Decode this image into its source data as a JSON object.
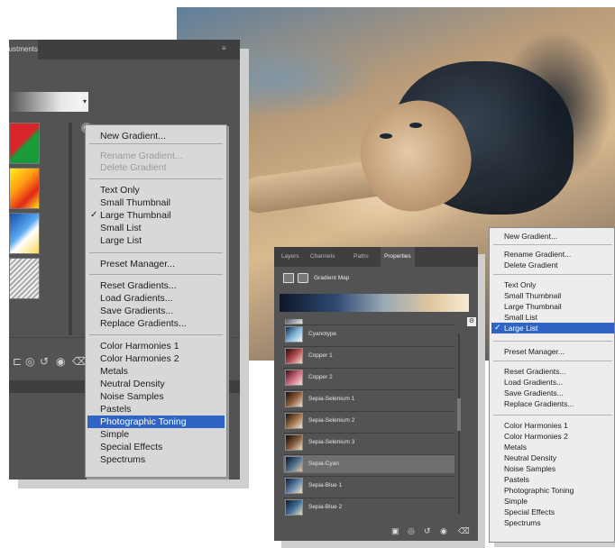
{
  "left_panel": {
    "tab_label": "Adjustments",
    "menu": {
      "items": [
        {
          "label": "New Gradient...",
          "state": "normal"
        },
        {
          "label": "Rename Gradient...",
          "state": "disabled"
        },
        {
          "label": "Delete Gradient",
          "state": "disabled"
        },
        {
          "label": "Text Only",
          "state": "normal"
        },
        {
          "label": "Small Thumbnail",
          "state": "normal"
        },
        {
          "label": "Large Thumbnail",
          "state": "checked"
        },
        {
          "label": "Small List",
          "state": "normal"
        },
        {
          "label": "Large List",
          "state": "normal"
        },
        {
          "label": "Preset Manager...",
          "state": "normal"
        },
        {
          "label": "Reset Gradients...",
          "state": "normal"
        },
        {
          "label": "Load Gradients...",
          "state": "normal"
        },
        {
          "label": "Save Gradients...",
          "state": "normal"
        },
        {
          "label": "Replace Gradients...",
          "state": "normal"
        },
        {
          "label": "Color Harmonies 1",
          "state": "normal"
        },
        {
          "label": "Color Harmonies 2",
          "state": "normal"
        },
        {
          "label": "Metals",
          "state": "normal"
        },
        {
          "label": "Neutral Density",
          "state": "normal"
        },
        {
          "label": "Noise Samples",
          "state": "normal"
        },
        {
          "label": "Pastels",
          "state": "normal"
        },
        {
          "label": "Photographic Toning",
          "state": "selected"
        },
        {
          "label": "Simple",
          "state": "normal"
        },
        {
          "label": "Special Effects",
          "state": "normal"
        },
        {
          "label": "Spectrums",
          "state": "normal"
        }
      ]
    }
  },
  "properties_panel": {
    "tabs": [
      "Layers",
      "Channels",
      "Paths",
      "Properties"
    ],
    "active_tab": "Properties",
    "header_label": "Gradient Map",
    "gradient_rows": [
      {
        "label": "Cyanotype",
        "highlighted": false
      },
      {
        "label": "Copper 1",
        "highlighted": false
      },
      {
        "label": "Copper 2",
        "highlighted": false
      },
      {
        "label": "Sepia-Selenium 1",
        "highlighted": false
      },
      {
        "label": "Sepia-Selenium 2",
        "highlighted": false
      },
      {
        "label": "Sepia-Selenium 3",
        "highlighted": false
      },
      {
        "label": "Sepia-Cyan",
        "highlighted": true
      },
      {
        "label": "Sepia-Blue 1",
        "highlighted": false
      },
      {
        "label": "Sepia-Blue 2",
        "highlighted": false
      }
    ]
  },
  "right_menu": {
    "items": [
      {
        "label": "New Gradient...",
        "state": "normal"
      },
      {
        "label": "Rename Gradient...",
        "state": "normal"
      },
      {
        "label": "Delete Gradient",
        "state": "normal"
      },
      {
        "label": "Text Only",
        "state": "normal"
      },
      {
        "label": "Small Thumbnail",
        "state": "normal"
      },
      {
        "label": "Large Thumbnail",
        "state": "normal"
      },
      {
        "label": "Small List",
        "state": "normal"
      },
      {
        "label": "Large List",
        "state": "selected"
      },
      {
        "label": "Preset Manager...",
        "state": "normal"
      },
      {
        "label": "Reset Gradients...",
        "state": "normal"
      },
      {
        "label": "Load Gradients...",
        "state": "normal"
      },
      {
        "label": "Save Gradients...",
        "state": "normal"
      },
      {
        "label": "Replace Gradients...",
        "state": "normal"
      },
      {
        "label": "Color Harmonies 1",
        "state": "normal"
      },
      {
        "label": "Color Harmonies 2",
        "state": "normal"
      },
      {
        "label": "Metals",
        "state": "normal"
      },
      {
        "label": "Neutral Density",
        "state": "normal"
      },
      {
        "label": "Noise Samples",
        "state": "normal"
      },
      {
        "label": "Pastels",
        "state": "normal"
      },
      {
        "label": "Photographic Toning",
        "state": "normal"
      },
      {
        "label": "Simple",
        "state": "normal"
      },
      {
        "label": "Special Effects",
        "state": "normal"
      },
      {
        "label": "Spectrums",
        "state": "normal"
      }
    ]
  },
  "colors": {
    "panel_bg": "#535353",
    "menu_bg": "#d8d8d8",
    "selection": "#2f64c4"
  }
}
